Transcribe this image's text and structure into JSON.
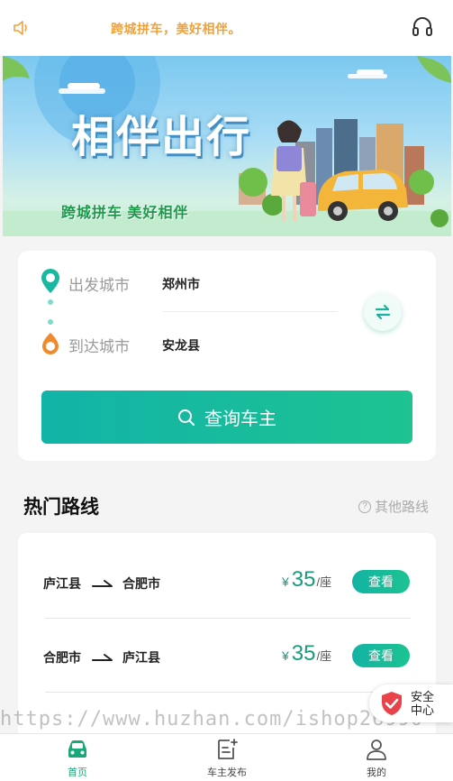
{
  "notice": {
    "text": "跨城拼车，美好相伴。"
  },
  "banner": {
    "title": "相伴出行",
    "subtitle": "跨城拼车 美好相伴"
  },
  "search": {
    "from_label": "出发城市",
    "from_value": "郑州市",
    "to_label": "到达城市",
    "to_value": "安龙县",
    "query_label": "查询车主"
  },
  "hot_routes": {
    "title": "热门路线",
    "other_label": "其他路线",
    "items": [
      {
        "from": "庐江县",
        "to": "合肥市",
        "currency": "¥",
        "price": "35",
        "unit": "/座",
        "action": "查看"
      },
      {
        "from": "合肥市",
        "to": "庐江县",
        "currency": "¥",
        "price": "35",
        "unit": "/座",
        "action": "查看"
      }
    ]
  },
  "watermark": "https://www.huzhan.com/ishop26990",
  "safety_center": {
    "line1": "安全",
    "line2": "中心"
  },
  "tabbar": {
    "items": [
      {
        "label": "首页",
        "icon": "car-icon",
        "active": true
      },
      {
        "label": "车主发布",
        "icon": "publish-icon",
        "active": false
      },
      {
        "label": "我的",
        "icon": "user-icon",
        "active": false
      }
    ]
  },
  "colors": {
    "accent": "#1dc391",
    "accent_dark": "#12b3a8",
    "notice": "#f0a23a",
    "price": "#1a9a7a"
  }
}
